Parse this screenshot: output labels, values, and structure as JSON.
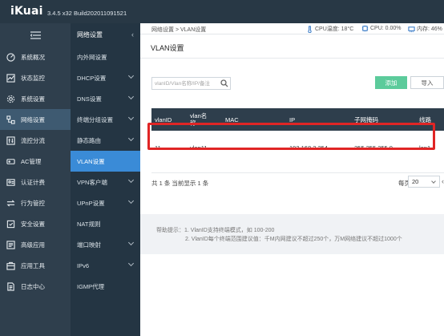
{
  "app": {
    "logo": "iKuai",
    "version": "3.4.5 x32 Build202011091521"
  },
  "sidebar": {
    "collapse_icon": "menu-collapse-icon",
    "items": [
      {
        "label": "系统概况",
        "icon": "dashboard-icon"
      },
      {
        "label": "状态监控",
        "icon": "monitor-icon"
      },
      {
        "label": "系统设置",
        "icon": "gear-icon"
      },
      {
        "label": "网络设置",
        "icon": "network-icon"
      },
      {
        "label": "流控分流",
        "icon": "sliders-icon"
      },
      {
        "label": "AC管理",
        "icon": "ac-icon"
      },
      {
        "label": "认证计费",
        "icon": "id-card-icon"
      },
      {
        "label": "行为管控",
        "icon": "arrows-icon"
      },
      {
        "label": "安全设置",
        "icon": "shield-icon"
      },
      {
        "label": "高级应用",
        "icon": "apps-icon"
      },
      {
        "label": "应用工具",
        "icon": "toolbox-icon"
      },
      {
        "label": "日志中心",
        "icon": "log-icon"
      }
    ],
    "active_index": 3
  },
  "submenu": {
    "title": "网络设置",
    "items": [
      {
        "label": "内外网设置",
        "has_caret": false
      },
      {
        "label": "DHCP设置",
        "has_caret": true
      },
      {
        "label": "DNS设置",
        "has_caret": true
      },
      {
        "label": "终端分组设置",
        "has_caret": true
      },
      {
        "label": "静态路由",
        "has_caret": true
      },
      {
        "label": "VLAN设置",
        "has_caret": false
      },
      {
        "label": "VPN客户端",
        "has_caret": true
      },
      {
        "label": "UPnP设置",
        "has_caret": true
      },
      {
        "label": "NAT规则",
        "has_caret": false
      },
      {
        "label": "端口映射",
        "has_caret": true
      },
      {
        "label": "IPv6",
        "has_caret": true
      },
      {
        "label": "IGMP代理",
        "has_caret": false
      }
    ],
    "active_index": 5
  },
  "header": {
    "breadcrumb": "网络设置 > VLAN设置",
    "cpu_temp": "CPU温度: 18°C",
    "cpu_usage": "CPU: 0.00%",
    "memory": "内存: 46%"
  },
  "page": {
    "title": "VLAN设置",
    "search_placeholder": "vlanID/Vlan名称/IP/备注",
    "add_label": "添加",
    "import_label": "导入"
  },
  "table": {
    "columns": [
      "vlanID",
      "vlan名称",
      "MAC",
      "IP",
      "子网掩码",
      "线路"
    ],
    "rows": [
      {
        "vlanid": "11",
        "name": "vlan11",
        "mac": "",
        "ip": "192.168.2.254",
        "mask": "255.255.255.0",
        "line": "lan1"
      }
    ],
    "highlight_color": "#e02525"
  },
  "pager": {
    "summary": "共 1 条 当前显示 1 条",
    "per_page_label": "每页",
    "per_page_value": "20"
  },
  "hints": {
    "line1": "帮助提示：1. VlanID支持终端模式，如 100-200",
    "line2": "2. VlanID每个终端范围建议值：千M内网建议不超过250个，万M网络建议不超过1000个"
  },
  "colors": {
    "topbar": "#283845",
    "sidebar": "#2f3f4d",
    "submenu": "#243543",
    "active_submenu": "#3a8bd7",
    "add_button": "#5ccb9b",
    "table_header": "#2e3e4c"
  }
}
